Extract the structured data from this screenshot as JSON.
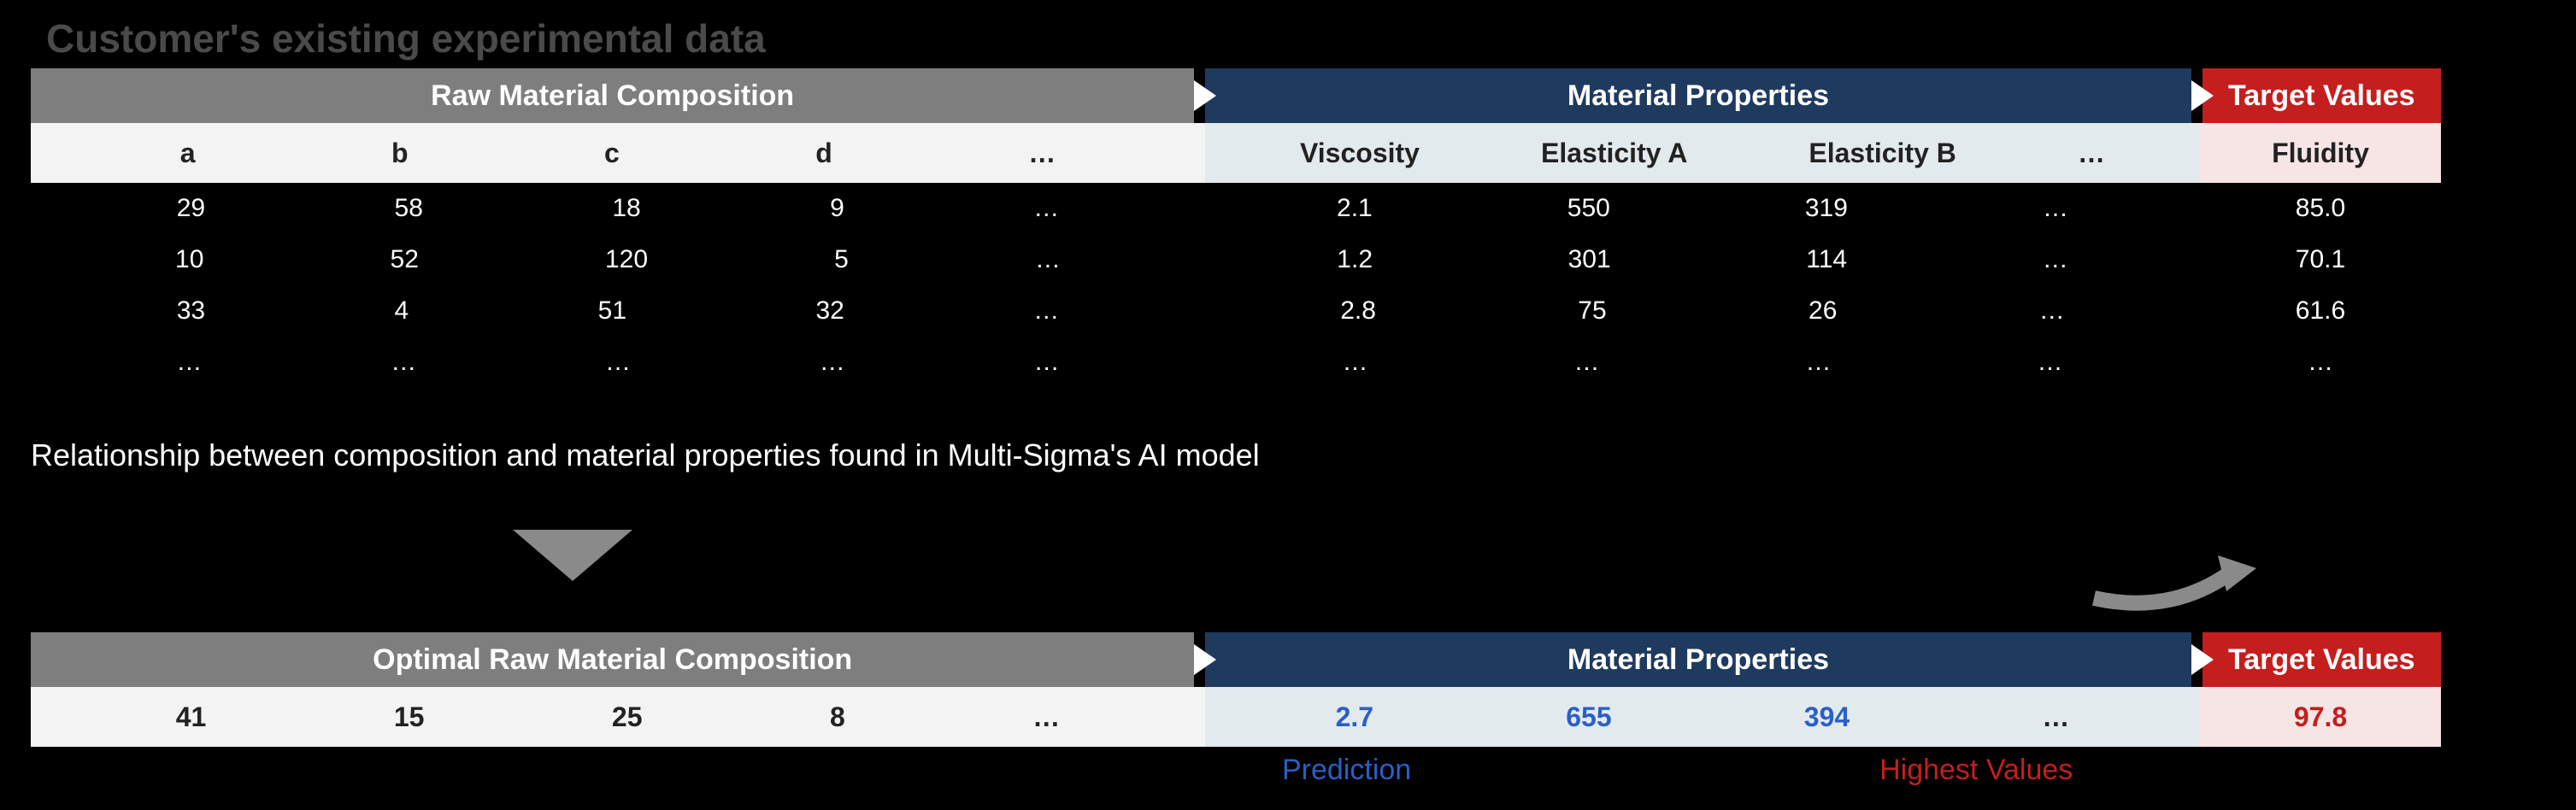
{
  "title": "Customer's existing experimental data",
  "headers": {
    "raw": "Raw Material Composition",
    "props": "Material Properties",
    "target": "Target Values"
  },
  "sub": {
    "raw": [
      "a",
      "b",
      "c",
      "d",
      "…"
    ],
    "props": [
      "Viscosity",
      "Elasticity A",
      "Elasticity B",
      "…"
    ],
    "target": "Fluidity"
  },
  "rows": [
    {
      "raw": [
        "29",
        "58",
        "18",
        "9",
        "…"
      ],
      "props": [
        "2.1",
        "550",
        "319",
        "…"
      ],
      "target": "85.0"
    },
    {
      "raw": [
        "10",
        "52",
        "120",
        "5",
        "…"
      ],
      "props": [
        "1.2",
        "301",
        "114",
        "…"
      ],
      "target": "70.1"
    },
    {
      "raw": [
        "33",
        "4",
        "51",
        "32",
        "…"
      ],
      "props": [
        "2.8",
        "75",
        "26",
        "…"
      ],
      "target": "61.6"
    },
    {
      "raw": [
        "…",
        "…",
        "…",
        "…",
        "…"
      ],
      "props": [
        "…",
        "…",
        "…",
        "…"
      ],
      "target": "…"
    }
  ],
  "explain": "Relationship between composition and material properties found in Multi-Sigma's AI model",
  "bottom": {
    "raw_label": "Optimal Raw Material Composition",
    "props_label": "Material Properties",
    "target_label": "Target Values",
    "raw": [
      "41",
      "15",
      "25",
      "8",
      "…"
    ],
    "props": [
      "2.7",
      "655",
      "394",
      "…"
    ],
    "target": "97.8",
    "annot": "Prediction",
    "annot2": "Highest Values"
  }
}
